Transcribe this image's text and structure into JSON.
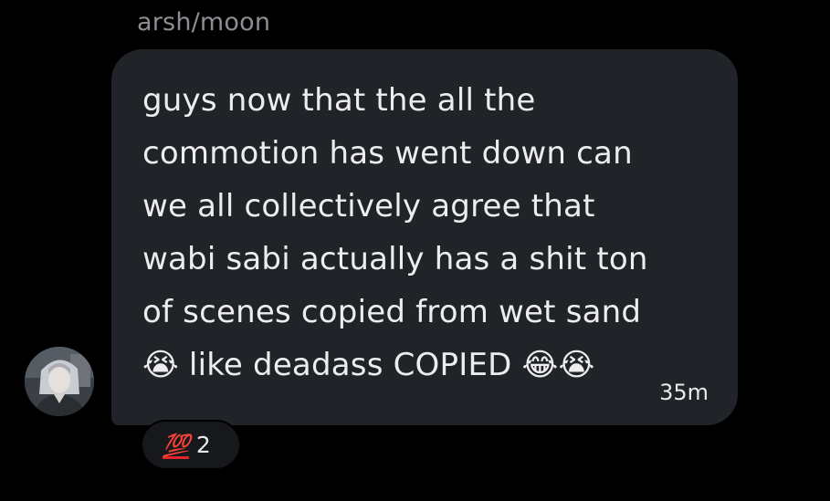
{
  "sender": {
    "name": "arsh/moon"
  },
  "message": {
    "text": "guys now that the all the\ncommotion has went down can\nwe all collectively agree that\nwabi sabi actually has a shit ton\nof scenes copied from wet sand\n😭 like deadass COPIED 😂😭",
    "time": "35m"
  },
  "reaction": {
    "emoji": "💯",
    "count": "2"
  },
  "colors": {
    "background": "#000000",
    "bubble": "#202327",
    "sender_text": "#8b8f94",
    "reaction_pill": "#16181c"
  },
  "icons": {
    "avatar": "user-avatar",
    "reaction": "hundred-points-icon"
  }
}
